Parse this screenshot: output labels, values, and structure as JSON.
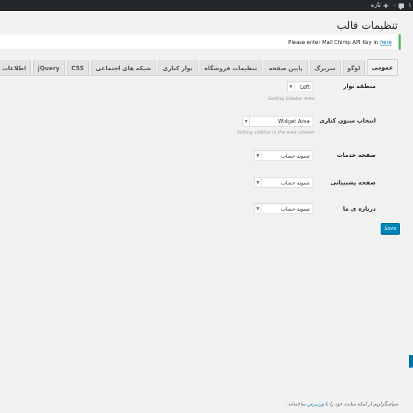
{
  "adminbar": {
    "new_label": "تازه",
    "comments_count": "۰",
    "updates_count": "۱"
  },
  "page": {
    "title": "تنظیمات قالب"
  },
  "notice": {
    "text": "Please enter Mail Chimp API Key in",
    "link": "here"
  },
  "tabs": [
    {
      "label": "عمومی",
      "active": true
    },
    {
      "label": "لوگو"
    },
    {
      "label": "سربرگ"
    },
    {
      "label": "پایین صفحه"
    },
    {
      "label": "تنظیمات فروشگاه"
    },
    {
      "label": "نوار کناری"
    },
    {
      "label": "شبکه های اجتماعی"
    },
    {
      "label": "CSS"
    },
    {
      "label": "jQuery"
    },
    {
      "label": "اطلاعات"
    }
  ],
  "form": {
    "sidebar_area": {
      "label": "منطقه نوار",
      "value": "Left",
      "hint": "Setting Sidebar Area"
    },
    "sidebar_column": {
      "label": "انتخاب ستون کناری",
      "value": "Widget Area",
      "hint": "Setting sidebar in the area sidebar"
    },
    "services_page": {
      "label": "صفحه خدمات",
      "value": "تسویه حساب"
    },
    "support_page": {
      "label": "صفحه پشتیبانی",
      "value": "تسویه حساب"
    },
    "about_page": {
      "label": "درباره ی ما",
      "value": "تسویه حساب"
    },
    "save_label": "Save"
  },
  "footer": {
    "text_before": "سپاسگزاریم از اینکه سایت خود را با",
    "link": "وردپرس",
    "text_after": "ساخته‌اید."
  },
  "colors": {
    "adminbar": "#23282d",
    "accent": "#0085ba",
    "notice_border": "#46b450"
  }
}
